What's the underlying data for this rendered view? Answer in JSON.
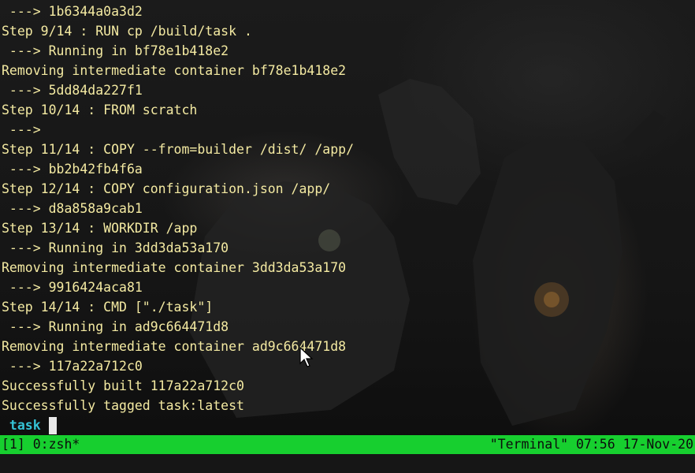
{
  "terminal": {
    "lines": [
      " ---> 1b6344a0a3d2",
      "Step 9/14 : RUN cp /build/task .",
      " ---> Running in bf78e1b418e2",
      "Removing intermediate container bf78e1b418e2",
      " ---> 5dd84da227f1",
      "Step 10/14 : FROM scratch",
      " --->",
      "Step 11/14 : COPY --from=builder /dist/ /app/",
      " ---> bb2b42fb4f6a",
      "Step 12/14 : COPY configuration.json /app/",
      " ---> d8a858a9cab1",
      "Step 13/14 : WORKDIR /app",
      " ---> Running in 3dd3da53a170",
      "Removing intermediate container 3dd3da53a170",
      " ---> 9916424aca81",
      "Step 14/14 : CMD [\"./task\"]",
      " ---> Running in ad9c664471d8",
      "Removing intermediate container ad9c664471d8",
      " ---> 117a22a712c0",
      "Successfully built 117a22a712c0",
      "Successfully tagged task:latest"
    ],
    "prompt": " task",
    "text_color": "#f4eaa2",
    "prompt_color": "#35c3d6"
  },
  "statusbar": {
    "left": "[1] 0:zsh*",
    "right": "\"Terminal\" 07:56 17-Nov-20",
    "background": "#17cf2f"
  },
  "icons": {
    "pointer": "mouse-pointer-icon",
    "cursor": "text-cursor-icon"
  }
}
